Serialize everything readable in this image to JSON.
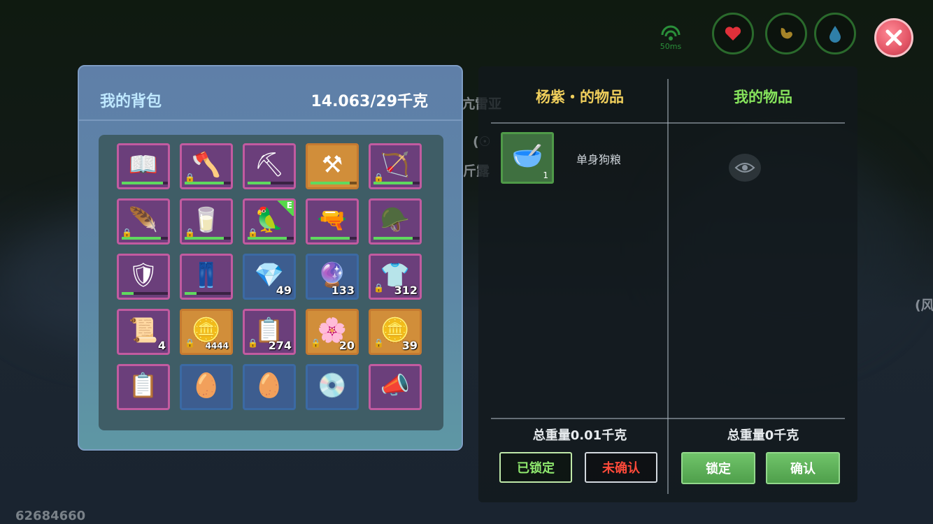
{
  "hud": {
    "ping": "50ms",
    "stats": [
      {
        "name": "health",
        "color": "#e0303a"
      },
      {
        "name": "hunger",
        "color": "#c8a23a"
      },
      {
        "name": "thirst",
        "color": "#2f6f8f"
      }
    ]
  },
  "background_text": {
    "line1": "亢雷亚",
    "line2": "(☉",
    "line3": "斤露",
    "line4": "(风"
  },
  "backpack": {
    "title": "我的背包",
    "weight": "14.063/29千克",
    "items": [
      {
        "icon": "book-icon",
        "art": "📖",
        "rarity": "purple",
        "durability": 0.9,
        "locked": false,
        "count": ""
      },
      {
        "icon": "scythe-icon",
        "art": "🪓",
        "rarity": "purple",
        "durability": 0.85,
        "locked": true,
        "count": ""
      },
      {
        "icon": "pickaxe-icon",
        "art": "⛏",
        "rarity": "purple",
        "durability": 0.5,
        "locked": false,
        "count": ""
      },
      {
        "icon": "pickaxe-gold-icon",
        "art": "⚒",
        "rarity": "orange",
        "durability": 0.85,
        "locked": false,
        "count": ""
      },
      {
        "icon": "crossbow-icon",
        "art": "🏹",
        "rarity": "purple",
        "durability": 0.85,
        "locked": true,
        "count": ""
      },
      {
        "icon": "feather-icon",
        "art": "🪶",
        "rarity": "purple",
        "durability": 0.85,
        "locked": true,
        "count": ""
      },
      {
        "icon": "milk-carton-icon",
        "art": "🥛",
        "rarity": "purple",
        "durability": 0.85,
        "locked": true,
        "count": ""
      },
      {
        "icon": "bird-staff-icon",
        "art": "🦜",
        "rarity": "purple",
        "durability": 0.85,
        "locked": true,
        "count": "",
        "badge": "E"
      },
      {
        "icon": "rifle-icon",
        "art": "🔫",
        "rarity": "purple",
        "durability": 0.85,
        "locked": false,
        "count": ""
      },
      {
        "icon": "helmet-icon",
        "art": "🪖",
        "rarity": "purple",
        "durability": 0.85,
        "locked": false,
        "count": ""
      },
      {
        "icon": "chest-armor-icon",
        "art": "🛡",
        "rarity": "purple",
        "durability": 0.25,
        "locked": false,
        "count": ""
      },
      {
        "icon": "leg-armor-icon",
        "art": "👖",
        "rarity": "purple",
        "durability": 0.25,
        "locked": false,
        "count": ""
      },
      {
        "icon": "blue-crystal-icon",
        "art": "💎",
        "rarity": "blue",
        "durability": null,
        "locked": false,
        "count": "49"
      },
      {
        "icon": "purple-crystal-icon",
        "art": "🔮",
        "rarity": "blue",
        "durability": null,
        "locked": false,
        "count": "133"
      },
      {
        "icon": "yellow-shirt-icon",
        "art": "👕",
        "rarity": "purple",
        "durability": null,
        "locked": true,
        "count": "312"
      },
      {
        "icon": "scroll-icon",
        "art": "📜",
        "rarity": "purple",
        "durability": null,
        "locked": false,
        "count": "4"
      },
      {
        "icon": "gold-coin-icon",
        "art": "🪙",
        "rarity": "orange",
        "durability": null,
        "locked": true,
        "count": "4444",
        "small": true
      },
      {
        "icon": "wanted-poster-icon",
        "art": "📋",
        "rarity": "purple",
        "durability": null,
        "locked": true,
        "count": "274"
      },
      {
        "icon": "flower-badge-icon",
        "art": "🌸",
        "rarity": "orange",
        "durability": null,
        "locked": true,
        "count": "20"
      },
      {
        "icon": "gold-coin-icon",
        "art": "🪙",
        "rarity": "orange",
        "durability": null,
        "locked": true,
        "count": "39"
      },
      {
        "icon": "wanted-poster-icon",
        "art": "📋",
        "rarity": "purple",
        "durability": null,
        "locked": false,
        "count": ""
      },
      {
        "icon": "teal-egg-icon",
        "art": "🥚",
        "rarity": "blue",
        "durability": null,
        "locked": false,
        "count": ""
      },
      {
        "icon": "teal-egg-icon",
        "art": "🥚",
        "rarity": "blue",
        "durability": null,
        "locked": false,
        "count": ""
      },
      {
        "icon": "disc-icon",
        "art": "💿",
        "rarity": "blue",
        "durability": null,
        "locked": false,
        "count": ""
      },
      {
        "icon": "megaphone-icon",
        "art": "📣",
        "rarity": "purple",
        "durability": null,
        "locked": false,
        "count": ""
      }
    ]
  },
  "trade": {
    "their_title": "杨紫・的物品",
    "my_title": "我的物品",
    "their_items": [
      {
        "icon": "dog-food-bowl-icon",
        "art": "🥣",
        "name": "单身狗粮",
        "count": "1"
      }
    ],
    "their_weight": "总重量0.01千克",
    "my_weight": "总重量0千克",
    "their_status_locked": "已锁定",
    "their_status_unconfirmed": "未确认",
    "lock_button": "锁定",
    "confirm_button": "确认"
  },
  "player_id": "62684660"
}
